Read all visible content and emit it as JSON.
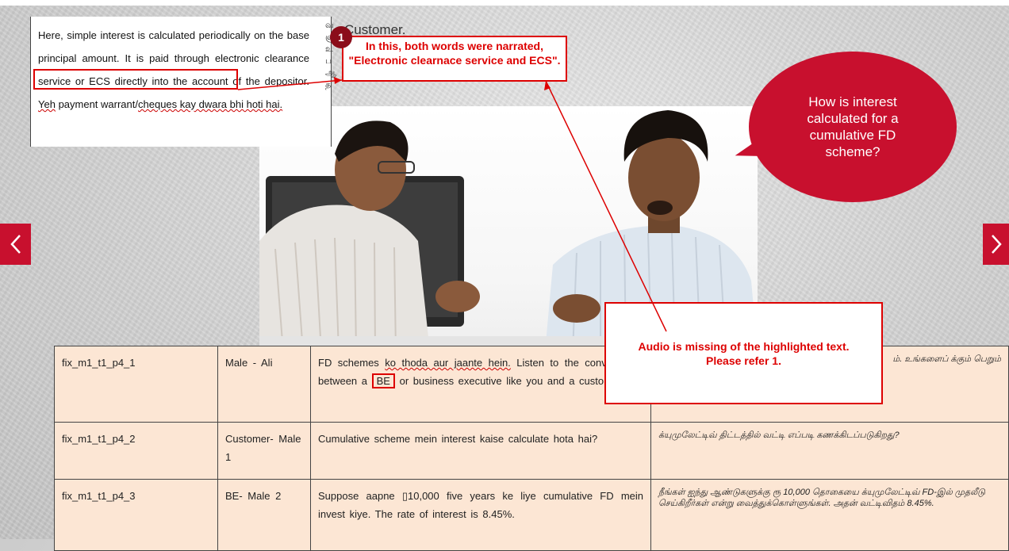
{
  "nav": {
    "prev_label": "‹",
    "next_label": "›"
  },
  "bubble": {
    "question": "How is interest calculated for a cumulative FD scheme?"
  },
  "doc_excerpt": {
    "text": "Here, simple interest is calculated periodically on the base principal amount. It is paid through",
    "ecs_phrase": "electronic clearance service or ECS",
    "text_after": "directly into the account of the depositor.",
    "yeh": "Yeh",
    "text_tail": "payment warrant/",
    "hinglish": "cheques kay dwara bhi hoti hai."
  },
  "customer_label": "Customer.",
  "annotations": {
    "badge": "1",
    "callout_text": "In this, both words were narrated, \"Electronic clearnace service and ECS\".",
    "audio_note": "Audio is missing of the highlighted text. Please refer 1."
  },
  "table": {
    "rows": [
      {
        "id": "fix_m1_t1_p4_1",
        "speaker": "Male - Ali",
        "english_start": "FD schemes",
        "english_ko": "ko thoda aur jaante hein.",
        "english_cont": "Listen to the conversation between a",
        "english_be": "BE",
        "english_end": "or business executive like you and a customer.",
        "tamil": "ம். உங்களைப் க்கும் பெறும்"
      },
      {
        "id": "fix_m1_t1_p4_2",
        "speaker": "Customer- Male 1",
        "english_start": "Cumulative scheme",
        "english_hi": "mein interest kaise calculate hota hai?",
        "tamil": "க்யுமுலேட்டிவ் திட்டத்தில் வட்டி எப்படி கணக்கிடப்படுகிறது?"
      },
      {
        "id": "fix_m1_t1_p4_3",
        "speaker": "BE- Male 2",
        "english": "Suppose aapne ▯10,000 five years ke liye cumulative FD mein invest kiye. The rate of interest is 8.45%.",
        "tamil": "நீங்கள் ஐந்து ஆண்டுகளுக்கு ரூ 10,000 தொகையை க்யுமுலேட்டிவ் FD-இல் முதலீடு செய்கிறீர்கள் என்று வைத்துக்கொள்ளுங்கள். அதன் வட்டிவிதம் 8.45%."
      }
    ]
  },
  "colors": {
    "brand_red": "#c8102e",
    "annotation_red": "#dd0000",
    "table_bg": "#fce6d4"
  }
}
